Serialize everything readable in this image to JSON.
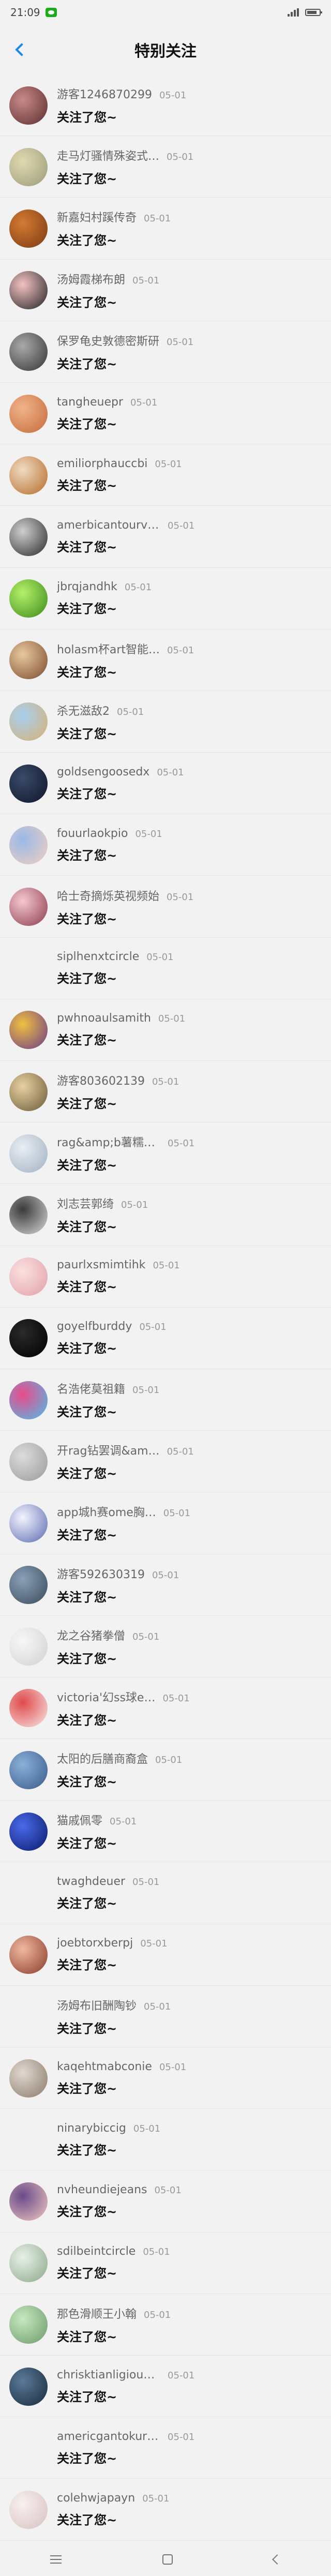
{
  "status_bar": {
    "time": "21:09"
  },
  "header": {
    "title": "特别关注",
    "back_icon": "back-chevron-icon",
    "accent": "#1e88e5"
  },
  "items": [
    {
      "name": "游客1246870299",
      "date": "05-01",
      "message": "关注了您~",
      "avatar": {
        "kind": "gradient",
        "c1": "#c98a8a",
        "c2": "#5a2d2d"
      }
    },
    {
      "name": "走马灯骚情殊姿式…",
      "date": "05-01",
      "message": "关注了您~",
      "avatar": {
        "kind": "gradient",
        "c1": "#e0d9b0",
        "c2": "#9a9a7a"
      }
    },
    {
      "name": "新嘉妇村蹊传奇",
      "date": "05-01",
      "message": "关注了您~",
      "avatar": {
        "kind": "gradient",
        "c1": "#d47a34",
        "c2": "#7a3a10"
      }
    },
    {
      "name": "汤姆霞梯布朗",
      "date": "05-01",
      "message": "关注了您~",
      "avatar": {
        "kind": "gradient",
        "c1": "#f4c2c2",
        "c2": "#222222"
      }
    },
    {
      "name": "保罗龟史敦德密斯研",
      "date": "05-01",
      "message": "关注了您~",
      "avatar": {
        "kind": "gradient",
        "c1": "#aaaaaa",
        "c2": "#333333"
      }
    },
    {
      "name": "tangheuepr",
      "date": "05-01",
      "message": "关注了您~",
      "avatar": {
        "kind": "gradient",
        "c1": "#f1b48a",
        "c2": "#c46a3a"
      }
    },
    {
      "name": "emiliorphauccbi",
      "date": "05-01",
      "message": "关注了您~",
      "avatar": {
        "kind": "gradient",
        "c1": "#f0dcc0",
        "c2": "#b46a2a"
      }
    },
    {
      "name": "amerbicantourvi…",
      "date": "05-01",
      "message": "关注了您~",
      "avatar": {
        "kind": "gradient",
        "c1": "#cfcfcf",
        "c2": "#2a2a2a"
      }
    },
    {
      "name": "jbrqjandhk",
      "date": "05-01",
      "message": "关注了您~",
      "avatar": {
        "kind": "gradient",
        "c1": "#b6f06a",
        "c2": "#3a8a1a"
      }
    },
    {
      "name": "holasm杯art智能…",
      "date": "05-01",
      "message": "关注了您~",
      "avatar": {
        "kind": "gradient",
        "c1": "#e8c8a0",
        "c2": "#7a4a2a"
      }
    },
    {
      "name": "杀无滋敌2",
      "date": "05-01",
      "message": "关注了您~",
      "avatar": {
        "kind": "gradient",
        "c1": "#a8d0f0",
        "c2": "#d8b070"
      }
    },
    {
      "name": "goldsengoosedx",
      "date": "05-01",
      "message": "关注了您~",
      "avatar": {
        "kind": "gradient",
        "c1": "#3a4a6a",
        "c2": "#0e1628"
      }
    },
    {
      "name": "fouurlaokpio",
      "date": "05-01",
      "message": "关注了您~",
      "avatar": {
        "kind": "gradient",
        "c1": "#9ab8e8",
        "c2": "#f0d0c0"
      }
    },
    {
      "name": "哈士奇摘烁英视频始",
      "date": "05-01",
      "message": "关注了您~",
      "avatar": {
        "kind": "gradient",
        "c1": "#f5c8d0",
        "c2": "#8a3a4a"
      }
    },
    {
      "name": "siplhenxtcircle",
      "date": "05-01",
      "message": "关注了您~",
      "avatar": {
        "kind": "empty",
        "c1": "",
        "c2": ""
      }
    },
    {
      "name": "pwhnoaulsamith",
      "date": "05-01",
      "message": "关注了您~",
      "avatar": {
        "kind": "gradient",
        "c1": "#f0c040",
        "c2": "#6a3a8a"
      }
    },
    {
      "name": "游客803602139",
      "date": "05-01",
      "message": "关注了您~",
      "avatar": {
        "kind": "gradient",
        "c1": "#e8d0a0",
        "c2": "#6a5a3a"
      }
    },
    {
      "name": "rag&amp;b薯糯o…",
      "date": "05-01",
      "message": "关注了您~",
      "avatar": {
        "kind": "gradient",
        "c1": "#e8eef4",
        "c2": "#a0b0c0"
      }
    },
    {
      "name": "刘志芸郭绮",
      "date": "05-01",
      "message": "关注了您~",
      "avatar": {
        "kind": "gradient",
        "c1": "#3a3a3a",
        "c2": "#d8d8d8"
      }
    },
    {
      "name": "paurlxsmimtihk",
      "date": "05-01",
      "message": "关注了您~",
      "avatar": {
        "kind": "gradient",
        "c1": "#fbe0e0",
        "c2": "#e0a0a8"
      }
    },
    {
      "name": "goyelfburddy",
      "date": "05-01",
      "message": "关注了您~",
      "avatar": {
        "kind": "gradient",
        "c1": "#2a2a2a",
        "c2": "#000000"
      }
    },
    {
      "name": "名浩佬莫祖籍",
      "date": "05-01",
      "message": "关注了您~",
      "avatar": {
        "kind": "gradient",
        "c1": "#ea4a8a",
        "c2": "#4ac0ea"
      }
    },
    {
      "name": "开rag钻罢调&am…",
      "date": "05-01",
      "message": "关注了您~",
      "avatar": {
        "kind": "gradient",
        "c1": "#dcdcdc",
        "c2": "#9a9a9a"
      }
    },
    {
      "name": "app城h赛ome胸…",
      "date": "05-01",
      "message": "关注了您~",
      "avatar": {
        "kind": "gradient",
        "c1": "#f4f4ff",
        "c2": "#5a6ab0"
      }
    },
    {
      "name": "游客592630319",
      "date": "05-01",
      "message": "关注了您~",
      "avatar": {
        "kind": "gradient",
        "c1": "#8aa0b8",
        "c2": "#3a4a5a"
      }
    },
    {
      "name": "龙之谷猪拳僧",
      "date": "05-01",
      "message": "关注了您~",
      "avatar": {
        "kind": "gradient",
        "c1": "#f8f8f8",
        "c2": "#d0d0d0"
      }
    },
    {
      "name": "victoria'幻ss球e…",
      "date": "05-01",
      "message": "关注了您~",
      "avatar": {
        "kind": "gradient",
        "c1": "#e04a4a",
        "c2": "#f8e8e8"
      }
    },
    {
      "name": "太阳的后膳商裔盒",
      "date": "05-01",
      "message": "关注了您~",
      "avatar": {
        "kind": "gradient",
        "c1": "#8ab0d8",
        "c2": "#3a5a8a"
      }
    },
    {
      "name": "猫戚佩零",
      "date": "05-01",
      "message": "关注了您~",
      "avatar": {
        "kind": "gradient",
        "c1": "#4a6aea",
        "c2": "#0a1a6a"
      }
    },
    {
      "name": "twaghdeuer",
      "date": "05-01",
      "message": "关注了您~",
      "avatar": {
        "kind": "empty",
        "c1": "",
        "c2": ""
      }
    },
    {
      "name": "joebtorxberpj",
      "date": "05-01",
      "message": "关注了您~",
      "avatar": {
        "kind": "gradient",
        "c1": "#f0b8a0",
        "c2": "#8a3a2a"
      }
    },
    {
      "name": "汤姆布旧酬陶钞",
      "date": "05-01",
      "message": "关注了您~",
      "avatar": {
        "kind": "empty",
        "c1": "",
        "c2": ""
      }
    },
    {
      "name": "kaqehtmabconie",
      "date": "05-01",
      "message": "关注了您~",
      "avatar": {
        "kind": "gradient",
        "c1": "#e0d8d0",
        "c2": "#8a7a6a"
      }
    },
    {
      "name": "ninarybiccig",
      "date": "05-01",
      "message": "关注了您~",
      "avatar": {
        "kind": "empty",
        "c1": "",
        "c2": ""
      }
    },
    {
      "name": "nvheundiejeans",
      "date": "05-01",
      "message": "关注了您~",
      "avatar": {
        "kind": "gradient",
        "c1": "#6a4a8a",
        "c2": "#f0c8c0"
      }
    },
    {
      "name": "sdilbeintcircle",
      "date": "05-01",
      "message": "关注了您~",
      "avatar": {
        "kind": "gradient",
        "c1": "#e8f0e8",
        "c2": "#8aa88a"
      }
    },
    {
      "name": "那色滑顺王小翰",
      "date": "05-01",
      "message": "关注了您~",
      "avatar": {
        "kind": "gradient",
        "c1": "#c8e8c0",
        "c2": "#6a9a6a"
      }
    },
    {
      "name": "chrisktianligioub…",
      "date": "05-01",
      "message": "关注了您~",
      "avatar": {
        "kind": "gradient",
        "c1": "#5a7a9a",
        "c2": "#1a2a3a"
      }
    },
    {
      "name": "americgantokuri…",
      "date": "05-01",
      "message": "关注了您~",
      "avatar": {
        "kind": "empty",
        "c1": "",
        "c2": ""
      }
    },
    {
      "name": "colehwjapayn",
      "date": "05-01",
      "message": "关注了您~",
      "avatar": {
        "kind": "gradient",
        "c1": "#f8f0f0",
        "c2": "#d8c0c0"
      }
    }
  ],
  "bottom_nav": {
    "menu_icon": "menu-icon",
    "home_icon": "home-icon",
    "back_icon": "system-back-icon"
  }
}
